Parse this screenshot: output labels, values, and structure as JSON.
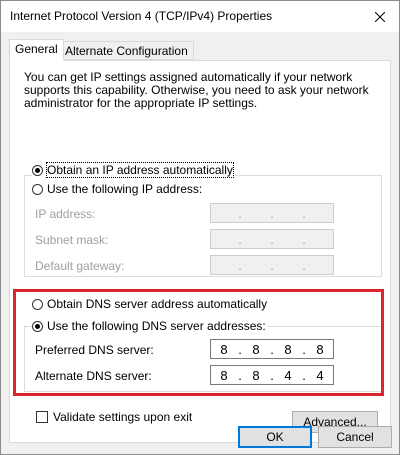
{
  "window": {
    "title": "Internet Protocol Version 4 (TCP/IPv4) Properties"
  },
  "tabs": [
    {
      "label": "General"
    },
    {
      "label": "Alternate Configuration"
    }
  ],
  "general": {
    "description": "You can get IP settings assigned automatically if your network supports this capability. Otherwise, you need to ask your network administrator for the appropriate IP settings.",
    "ip_auto": {
      "label": "Obtain an IP address automatically",
      "checked": true
    },
    "ip_manual": {
      "label": "Use the following IP address:",
      "checked": false
    },
    "ip_fields": [
      {
        "label": "IP address:",
        "value": [
          "",
          "",
          "",
          ""
        ]
      },
      {
        "label": "Subnet mask:",
        "value": [
          "",
          "",
          "",
          ""
        ]
      },
      {
        "label": "Default gateway:",
        "value": [
          "",
          "",
          "",
          ""
        ]
      }
    ],
    "dns_auto": {
      "label": "Obtain DNS server address automatically",
      "checked": false
    },
    "dns_manual": {
      "label": "Use the following DNS server addresses:",
      "checked": true
    },
    "dns_fields": [
      {
        "label": "Preferred DNS server:",
        "value": [
          "8",
          "8",
          "8",
          "8"
        ]
      },
      {
        "label": "Alternate DNS server:",
        "value": [
          "8",
          "8",
          "4",
          "4"
        ]
      }
    ],
    "validate": {
      "label": "Validate settings upon exit",
      "checked": false
    },
    "advanced_label": "Advanced..."
  },
  "footer": {
    "ok_label": "OK",
    "cancel_label": "Cancel"
  },
  "colors": {
    "highlight": "#d9252b",
    "accent": "#0078d7"
  },
  "icons": {
    "close": "close-icon"
  }
}
